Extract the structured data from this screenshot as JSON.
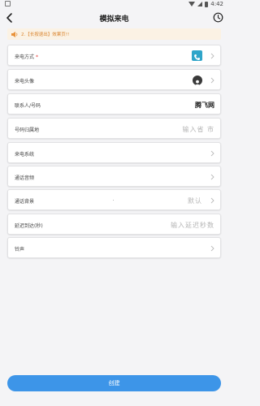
{
  "status_bar": {
    "time": "4:42"
  },
  "header": {
    "title": "模拟来电"
  },
  "notice": {
    "text": "2.【长按退出】效果页!!"
  },
  "form": {
    "rows": [
      {
        "label": "来电方式",
        "required_mark": "*",
        "accessory": "phone-icon"
      },
      {
        "label": "来电头像",
        "accessory": "avatar-icon"
      },
      {
        "label": "联系人/号码",
        "value": "腾飞网"
      },
      {
        "label": "号码归属地",
        "placeholder": "输入省 市"
      },
      {
        "label": "来电系统"
      },
      {
        "label": "通话音频"
      },
      {
        "label": "通话背景",
        "placeholder": "默认"
      },
      {
        "label": "延迟到达(秒)",
        "placeholder": "输入延迟秒数"
      },
      {
        "label": "铃声"
      }
    ]
  },
  "footer": {
    "create_label": "创建"
  },
  "colors": {
    "accent": "#3d95e8",
    "notice_bg": "#fbf2e4",
    "notice_text": "#d9822b",
    "phone_icon": "#2fa5c9",
    "required": "#e53935"
  }
}
